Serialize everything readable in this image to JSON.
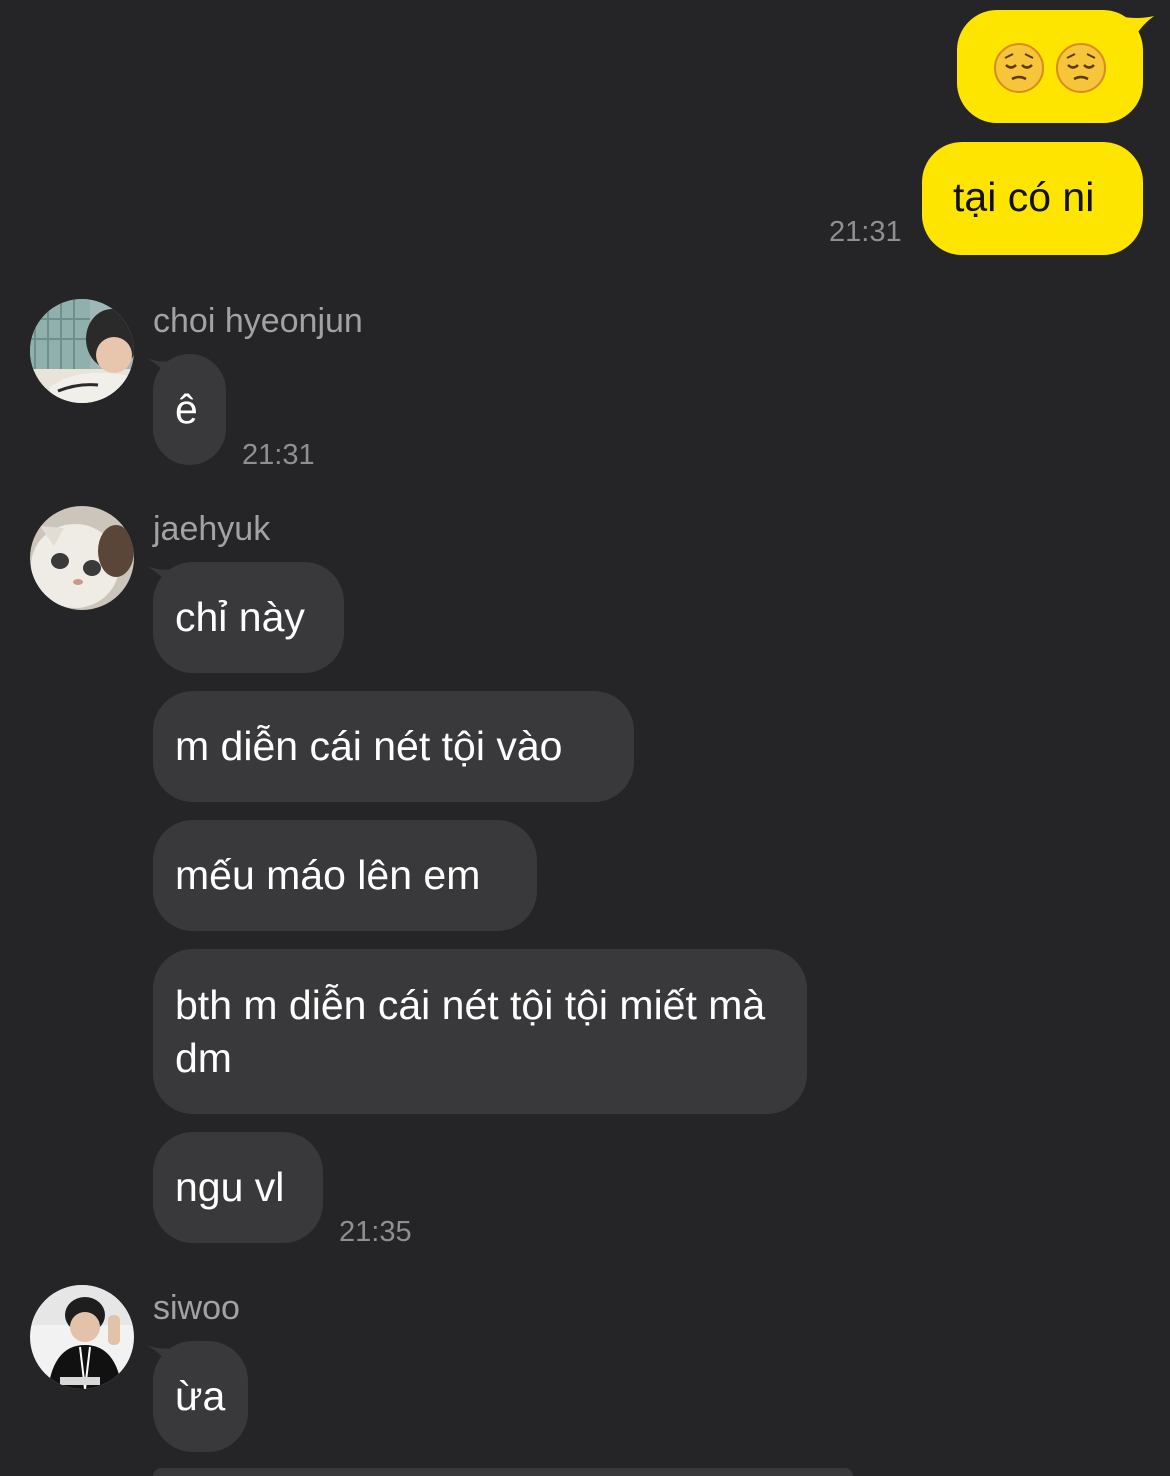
{
  "theme": {
    "background": "#252527",
    "my_bubble": "#fee500",
    "their_bubble": "#39393b",
    "time_color": "#8e8e93"
  },
  "messages": {
    "mine": {
      "emoji_pair": [
        "pensive-face",
        "pensive-face"
      ],
      "text": "tại có ni",
      "time": "21:31"
    },
    "choi": {
      "sender": "choi hyeonjun",
      "text": "ê",
      "time": "21:31"
    },
    "jaehyuk": {
      "sender": "jaehyuk",
      "texts": [
        "chỉ này",
        "m diễn cái nét tội vào",
        "mếu máo lên em",
        "bth m diễn cái nét tội tội miết mà dm",
        "ngu vl"
      ],
      "time": "21:35"
    },
    "siwoo": {
      "sender": "siwoo",
      "text": "ừa"
    }
  }
}
